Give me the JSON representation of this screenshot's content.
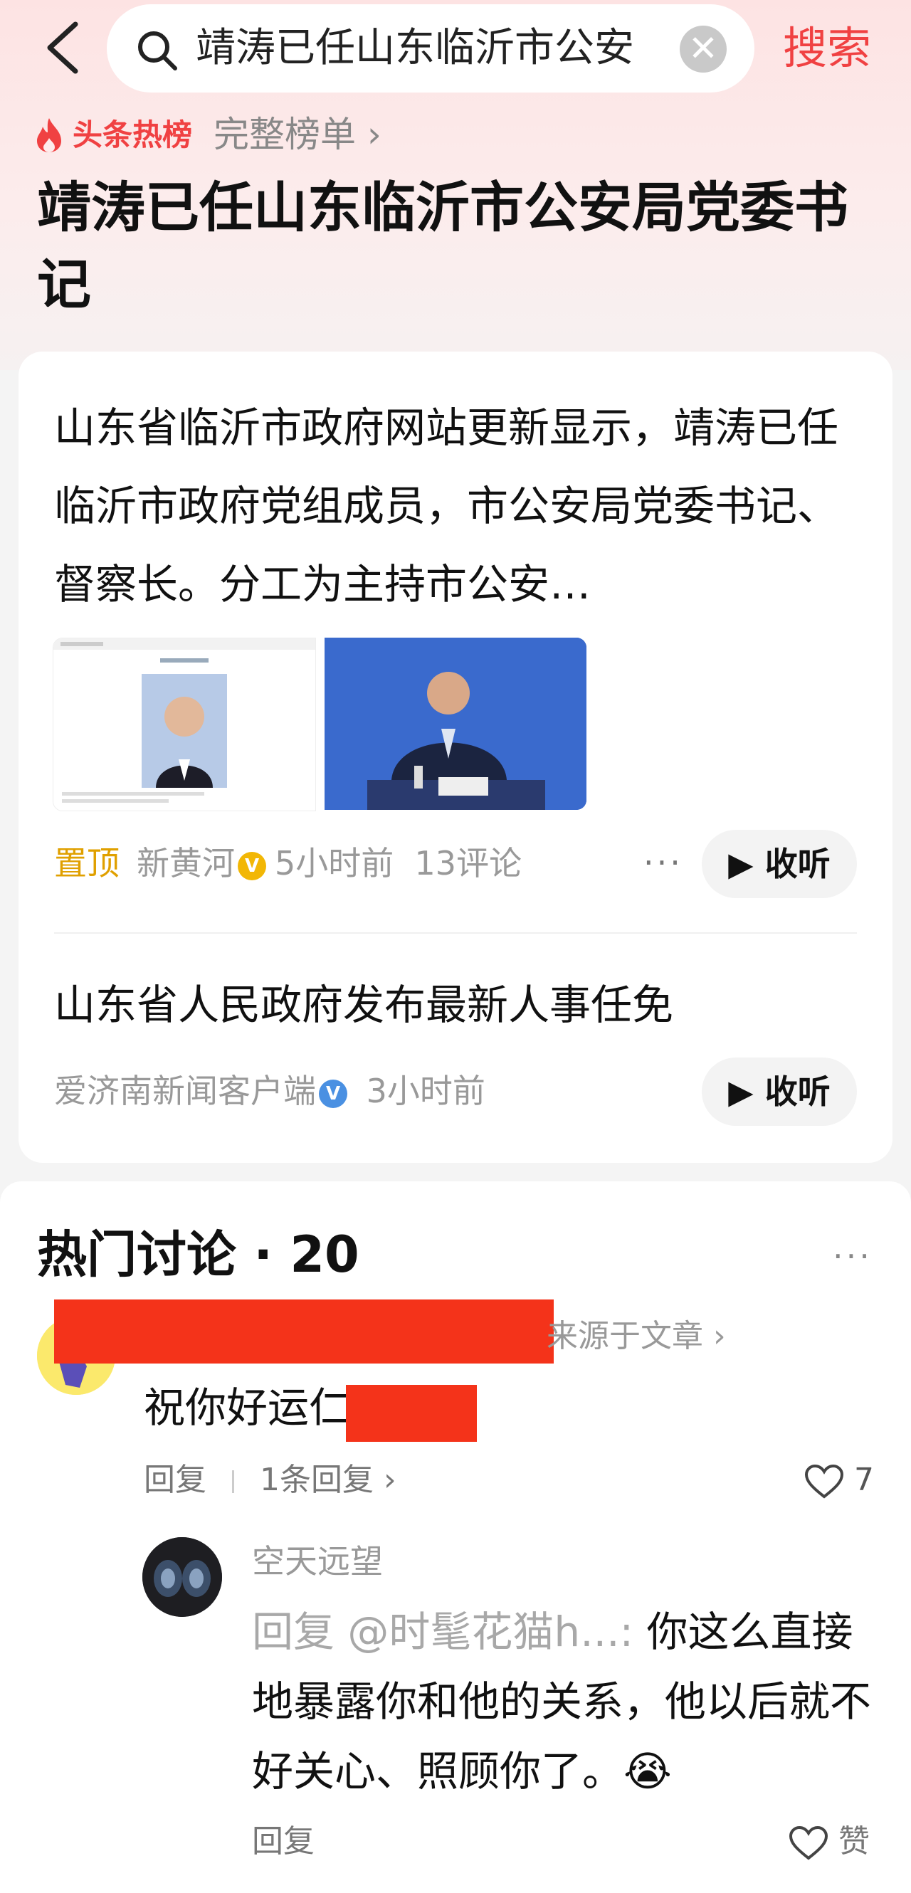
{
  "search": {
    "query": "靖涛已任山东临沂市公安",
    "clear_symbol": "✕",
    "button_label": "搜索"
  },
  "hot": {
    "brand": "头条热榜",
    "full_list": "完整榜单 ›",
    "title": "靖涛已任山东临沂市公安局党委书记"
  },
  "news1": {
    "summary": "山东省临沂市政府网站更新显示，靖涛已任临沂市政府党组成员，市公安局党委书记、督察长。分工为主持市公安…",
    "pin": "置顶",
    "source": "新黄河",
    "time": "5小时前",
    "comments": "13评论",
    "more": "···",
    "listen": "收听"
  },
  "news2": {
    "title": "山东省人民政府发布最新人事任免",
    "source": "爱济南新闻客户端",
    "time": "3小时前",
    "listen": "收听"
  },
  "badge": {
    "letter": "V",
    "color_gold": "#f2b705",
    "color_blue": "#4a90e2"
  },
  "discussion": {
    "title": "热门讨论 · 20",
    "more": "···",
    "comment": {
      "source": "来源于文章 ›",
      "text": "祝你好运仁途祝贺",
      "reply": "回复",
      "reply_count": "1条回复 ›",
      "likes": "7"
    },
    "reply": {
      "user": "空天远望",
      "prefix": "回复 @时髦花猫h...: ",
      "text": "你这么直接地暴露你和他的关系，他以后就不好关心、照顾你了。😭",
      "reply": "回复",
      "like": "赞"
    }
  },
  "colors": {
    "accent": "#f04142",
    "pin": "#e0a000",
    "redaction": "#f4331a"
  }
}
